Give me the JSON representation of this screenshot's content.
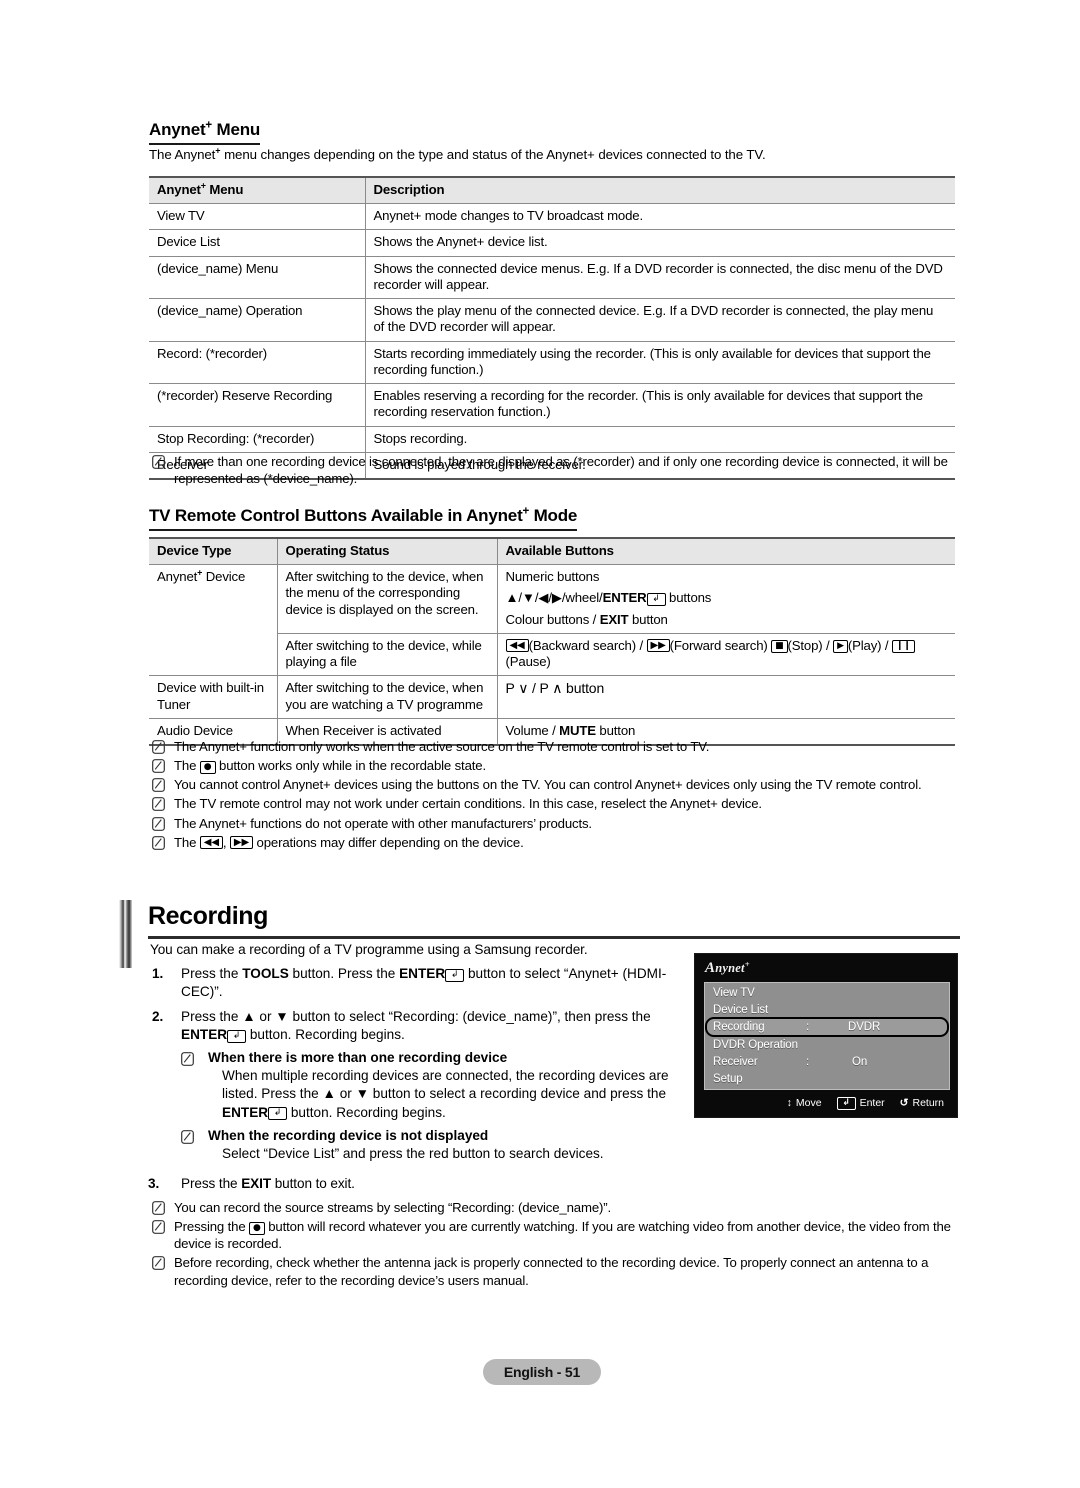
{
  "page": {
    "footer_label": "English - 51"
  },
  "section1": {
    "heading_pre": "Anynet",
    "heading_sup": "+",
    "heading_post": " Menu",
    "intro_a": "The Anynet",
    "intro_sup": "+",
    "intro_b": " menu changes depending on the type and status of the Anynet+ devices connected to the TV.",
    "table": {
      "headers": [
        "Anynet+ Menu",
        "Description"
      ],
      "header_col1_pre": "Anynet",
      "header_col1_sup": "+",
      "header_col1_post": " Menu",
      "rows": [
        {
          "menu": "View TV",
          "desc": "Anynet+ mode changes to TV broadcast mode."
        },
        {
          "menu": "Device List",
          "desc": "Shows the Anynet+ device list."
        },
        {
          "menu": "(device_name) Menu",
          "desc": "Shows the connected device menus. E.g. If a DVD recorder is connected, the disc menu of the DVD recorder will appear."
        },
        {
          "menu": "(device_name) Operation",
          "desc": "Shows the play menu of the connected device. E.g. If a DVD recorder is connected, the play menu of the DVD recorder will appear."
        },
        {
          "menu": "Record: (*recorder)",
          "desc": "Starts recording immediately using the recorder. (This is only available for devices that support the recording function.)"
        },
        {
          "menu": "(*recorder) Reserve Recording",
          "desc": "Enables reserving a recording for the recorder. (This is only available for devices that support the recording reservation function.)"
        },
        {
          "menu": "Stop Recording: (*recorder)",
          "desc": "Stops recording."
        },
        {
          "menu": "Receiver",
          "desc": "Sound is played through the receiver."
        }
      ]
    },
    "note": "If more than one recording device is connected, they are displayed as (*recorder) and if only one recording device is connected, it will be represented as (*device_name)."
  },
  "section2": {
    "heading_pre": "TV Remote Control Buttons Available in Anynet",
    "heading_sup": "+",
    "heading_post": " Mode",
    "table": {
      "headers": [
        "Device Type",
        "Operating Status",
        "Available Buttons"
      ],
      "row1": {
        "device_pre": "Anynet",
        "device_sup": "+",
        "device_post": " Device",
        "status_a": "After switching to the device, when the menu of the corresponding device is displayed on the screen.",
        "buttons_line1": "Numeric buttons",
        "buttons_line2_pre": "▲/▼/◀/▶/wheel/",
        "buttons_line2_bold": "ENTER",
        "buttons_line2_key": "↲",
        "buttons_line2_post": " buttons",
        "buttons_line3_pre": "Colour buttons / ",
        "buttons_line3_bold": "EXIT",
        "buttons_line3_post": " button",
        "status_b": "After switching to the device, while playing a file",
        "buttons_b": {
          "k1": "◀◀",
          "t1": "(Backward search) / ",
          "k2": "▶▶",
          "t2": "(Forward search) ",
          "k3": "■",
          "t3": "(Stop) / ",
          "k4": "▶",
          "t4": "(Play) / ",
          "k5": "❙❙",
          "t5": "(Pause)"
        }
      },
      "row2": {
        "device": "Device with built-in Tuner",
        "status": "After switching to the device, when you are watching a TV programme",
        "buttons_pre": "P ",
        "buttons_down": "∨",
        "buttons_mid": " / P ",
        "buttons_up": "∧",
        "buttons_post": " button"
      },
      "row3": {
        "device": "Audio Device",
        "status": "When Receiver is activated",
        "buttons_pre": "Volume / ",
        "buttons_bold": "MUTE",
        "buttons_post": " button"
      }
    },
    "notes": [
      {
        "text": "The Anynet+ function only works when the active source on the TV remote control is set to TV."
      },
      {
        "pre": "The ",
        "key": "●",
        "post": " button works only while in the recordable state."
      },
      {
        "text": "You cannot control Anynet+ devices using the buttons on the TV. You can control Anynet+ devices only using the TV remote control."
      },
      {
        "text": "The TV remote control may not work under certain conditions. In this case, reselect the Anynet+ device."
      },
      {
        "text": "The Anynet+ functions do not operate with other manufacturers’ products."
      },
      {
        "pre": "The ",
        "key": "◀◀",
        "mid": ", ",
        "key2": "▶▶",
        "post": " operations may differ depending on the device."
      }
    ]
  },
  "recording": {
    "title": "Recording",
    "intro": "You can make a recording of a TV programme using a Samsung recorder.",
    "steps": [
      {
        "num": "1.",
        "pre": "Press the ",
        "bold1": "TOOLS",
        "mid1": " button. Press the ",
        "bold2": "ENTER",
        "key": "↲",
        "post": " button to select “Anynet+ (HDMI-CEC)”."
      },
      {
        "num": "2.",
        "pre": "Press the ▲ or ▼ button to select “Recording: (device_name)”, then press the ",
        "bold2": "ENTER",
        "key": "↲",
        "post": " button. Recording begins.",
        "substeps": [
          {
            "head": "When there is more than one recording device",
            "body_pre": "When multiple recording devices are connected, the recording devices are listed. Press the ▲ or ▼ button to select a recording device and press the ",
            "body_bold": "ENTER",
            "body_key": "↲",
            "body_post": " button. Recording begins."
          },
          {
            "head": "When the recording device is not displayed",
            "body_pre": "Select “Device List” and press the red button to search devices."
          }
        ]
      },
      {
        "num": "3.",
        "pre": "Press the ",
        "bold1": "EXIT",
        "mid1": " button to exit."
      }
    ],
    "notes": [
      {
        "text": "You can record the source streams by selecting “Recording: (device_name)”."
      },
      {
        "pre": "Pressing the ",
        "key": "●",
        "post": " button will record whatever you are currently watching. If you are watching video from another device, the video from the device is recorded."
      },
      {
        "text": "Before recording, check whether the antenna jack is properly connected to the recording device. To properly connect an antenna to a recording device, refer to the recording device’s users manual."
      }
    ]
  },
  "osd": {
    "logo_cap": "A",
    "logo_rest": "nynet",
    "logo_sup": "+",
    "items": [
      {
        "label": "View TV",
        "colon": "",
        "value": ""
      },
      {
        "label": "Device List",
        "colon": "",
        "value": ""
      },
      {
        "label": "Recording",
        "colon": ":",
        "value": "DVDR"
      },
      {
        "label": "DVDR Operation",
        "colon": "",
        "value": ""
      },
      {
        "label": "Receiver",
        "colon": ":",
        "value": "On"
      },
      {
        "label": "Setup",
        "colon": "",
        "value": ""
      }
    ],
    "selected_index": 2,
    "footer": [
      {
        "icon": "↕",
        "label": "Move"
      },
      {
        "icon": "↲",
        "label": "Enter"
      },
      {
        "icon": "↺",
        "label": "Return"
      }
    ]
  }
}
